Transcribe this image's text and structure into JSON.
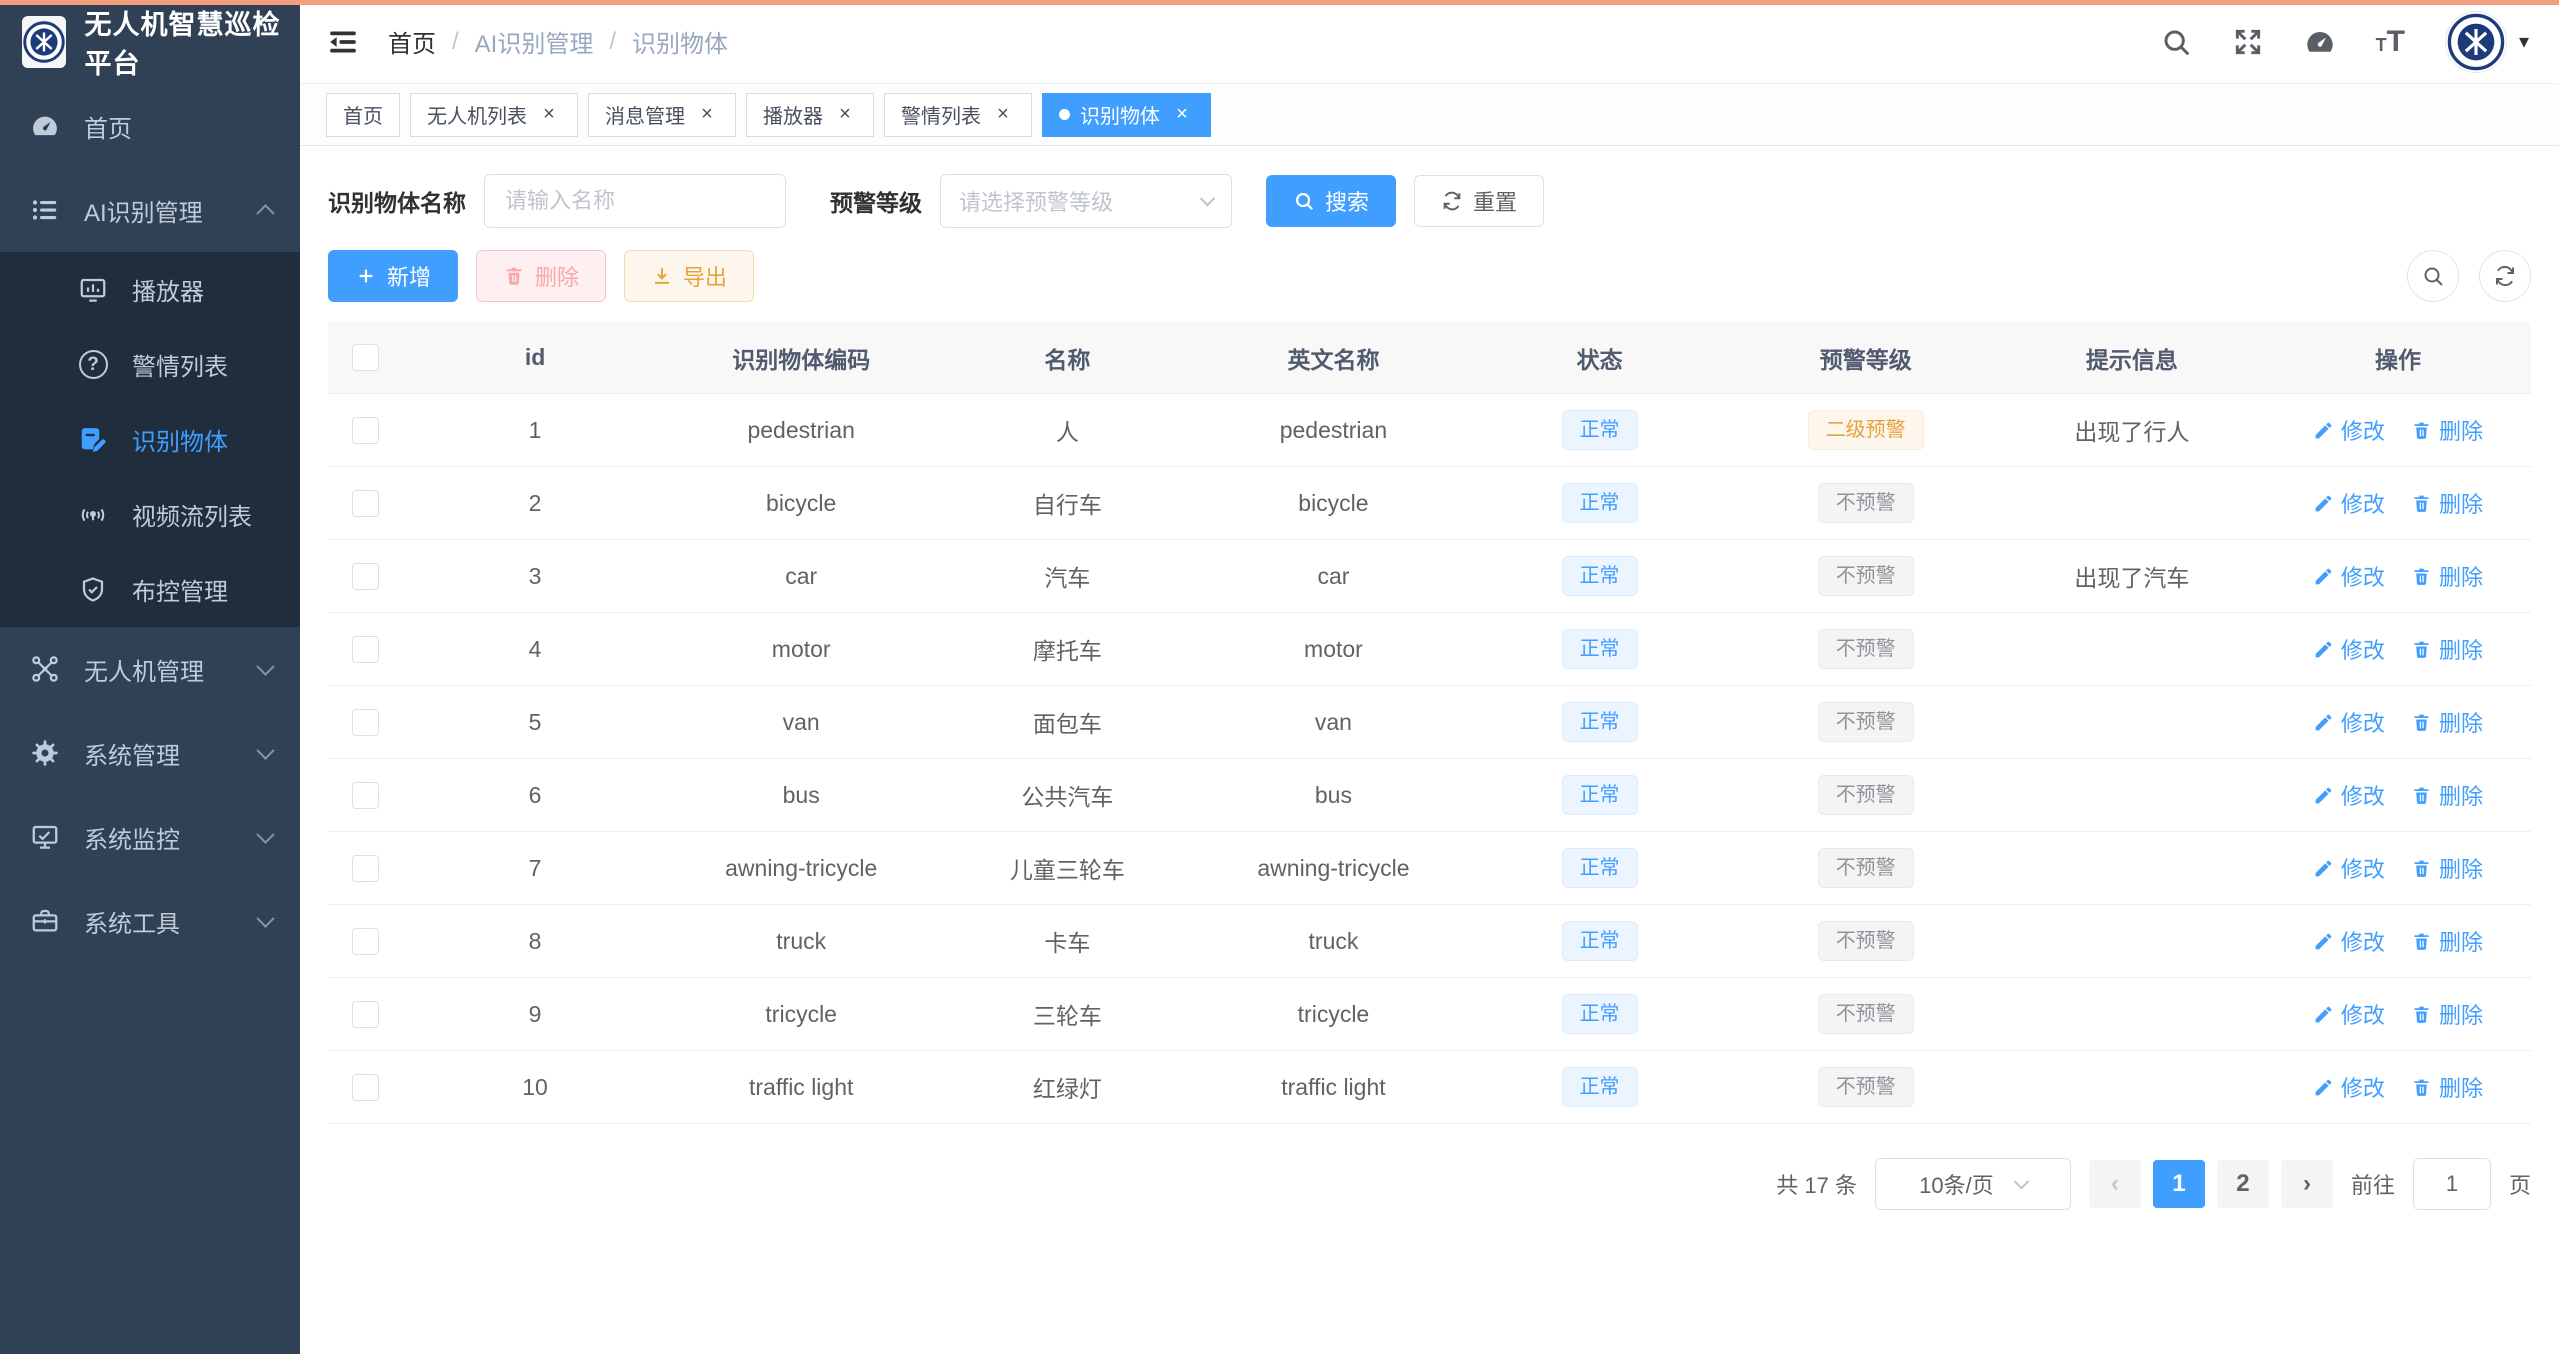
{
  "app": {
    "title": "无人机智慧巡检平台"
  },
  "breadcrumb": {
    "items": [
      "首页",
      "AI识别管理",
      "识别物体"
    ],
    "separator": "/"
  },
  "tabs": [
    {
      "label": "首页",
      "closable": false,
      "active": false
    },
    {
      "label": "无人机列表",
      "closable": true,
      "active": false
    },
    {
      "label": "消息管理",
      "closable": true,
      "active": false
    },
    {
      "label": "播放器",
      "closable": true,
      "active": false
    },
    {
      "label": "警情列表",
      "closable": true,
      "active": false
    },
    {
      "label": "识别物体",
      "closable": true,
      "active": true
    }
  ],
  "tab_close_glyph": "×",
  "sidebar": {
    "items": [
      {
        "label": "首页"
      },
      {
        "label": "AI识别管理",
        "expanded": true,
        "children": [
          "播放器",
          "警情列表",
          "识别物体",
          "视频流列表",
          "布控管理"
        ],
        "active_child": "识别物体"
      },
      {
        "label": "无人机管理"
      },
      {
        "label": "系统管理"
      },
      {
        "label": "系统监控"
      },
      {
        "label": "系统工具"
      }
    ]
  },
  "filters": {
    "name_label": "识别物体名称",
    "name_placeholder": "请输入名称",
    "level_label": "预警等级",
    "level_placeholder": "请选择预警等级",
    "search_label": "搜索",
    "reset_label": "重置"
  },
  "toolbar": {
    "add_label": "新增",
    "delete_label": "删除",
    "export_label": "导出"
  },
  "table": {
    "columns": [
      "id",
      "识别物体编码",
      "名称",
      "英文名称",
      "状态",
      "预警等级",
      "提示信息",
      "操作"
    ],
    "edit_label": "修改",
    "delete_label": "删除",
    "rows": [
      {
        "id": "1",
        "code": "pedestrian",
        "name": "人",
        "en": "pedestrian",
        "status": "正常",
        "level": "二级预警",
        "level_type": "warning",
        "tip": "出现了行人"
      },
      {
        "id": "2",
        "code": "bicycle",
        "name": "自行车",
        "en": "bicycle",
        "status": "正常",
        "level": "不预警",
        "level_type": "info",
        "tip": ""
      },
      {
        "id": "3",
        "code": "car",
        "name": "汽车",
        "en": "car",
        "status": "正常",
        "level": "不预警",
        "level_type": "info",
        "tip": "出现了汽车"
      },
      {
        "id": "4",
        "code": "motor",
        "name": "摩托车",
        "en": "motor",
        "status": "正常",
        "level": "不预警",
        "level_type": "info",
        "tip": ""
      },
      {
        "id": "5",
        "code": "van",
        "name": "面包车",
        "en": "van",
        "status": "正常",
        "level": "不预警",
        "level_type": "info",
        "tip": ""
      },
      {
        "id": "6",
        "code": "bus",
        "name": "公共汽车",
        "en": "bus",
        "status": "正常",
        "level": "不预警",
        "level_type": "info",
        "tip": ""
      },
      {
        "id": "7",
        "code": "awning-tricycle",
        "name": "儿童三轮车",
        "en": "awning-tricycle",
        "status": "正常",
        "level": "不预警",
        "level_type": "info",
        "tip": ""
      },
      {
        "id": "8",
        "code": "truck",
        "name": "卡车",
        "en": "truck",
        "status": "正常",
        "level": "不预警",
        "level_type": "info",
        "tip": ""
      },
      {
        "id": "9",
        "code": "tricycle",
        "name": "三轮车",
        "en": "tricycle",
        "status": "正常",
        "level": "不预警",
        "level_type": "info",
        "tip": ""
      },
      {
        "id": "10",
        "code": "traffic light",
        "name": "红绿灯",
        "en": "traffic light",
        "status": "正常",
        "level": "不预警",
        "level_type": "info",
        "tip": ""
      }
    ]
  },
  "pagination": {
    "total": "共 17 条",
    "page_size": "10条/页",
    "prev": "‹",
    "next": "›",
    "pages": [
      "1",
      "2"
    ],
    "current_page": "1",
    "goto_label": "前往",
    "goto_value": "1",
    "unit_label": "页"
  },
  "icons": [
    "search-icon",
    "fullscreen-icon",
    "gauge-icon",
    "font-size-icon",
    "avatar",
    "caret-down-icon",
    "hamburger-icon",
    "dashboard-icon",
    "list-icon",
    "player-icon",
    "question-icon",
    "doc-edit-icon",
    "broadcast-icon",
    "shield-icon",
    "drone-icon",
    "gear-icon",
    "monitor-icon",
    "toolbox-icon",
    "plus-icon",
    "trash-icon",
    "download-icon",
    "refresh-icon",
    "edit-pencil-icon"
  ],
  "colors": {
    "accent": "#409EFF",
    "sidebar_bg": "#304156",
    "submenu_bg": "#1F2D3D",
    "warning": "#E6A23C",
    "info": "#909399",
    "danger_soft": "#F9A7A7",
    "loading_bar": "#F39E7D"
  }
}
